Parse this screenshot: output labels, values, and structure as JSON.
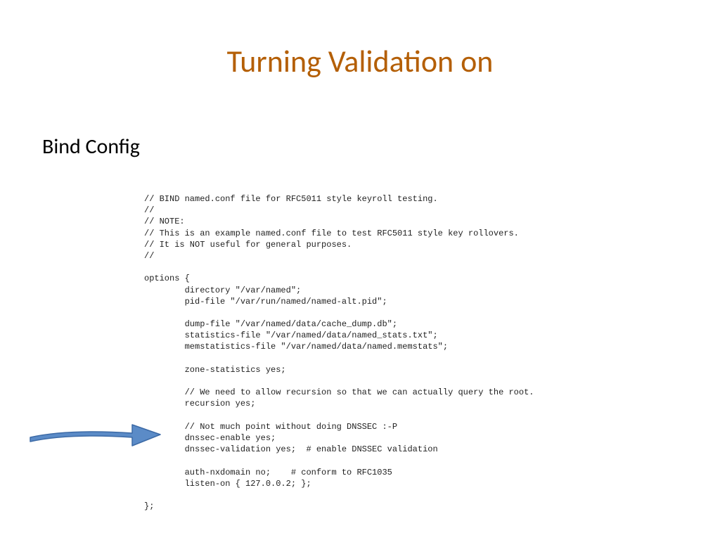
{
  "title": "Turning Validation on",
  "subtitle": "Bind Config",
  "code": "// BIND named.conf file for RFC5011 style keyroll testing.\n//\n// NOTE:\n// This is an example named.conf file to test RFC5011 style key rollovers.\n// It is NOT useful for general purposes.\n//\n\noptions {\n        directory \"/var/named\";\n        pid-file \"/var/run/named/named-alt.pid\";\n\n        dump-file \"/var/named/data/cache_dump.db\";\n        statistics-file \"/var/named/data/named_stats.txt\";\n        memstatistics-file \"/var/named/data/named.memstats\";\n\n        zone-statistics yes;\n\n        // We need to allow recursion so that we can actually query the root.\n        recursion yes;\n\n        // Not much point without doing DNSSEC :-P\n        dnssec-enable yes;\n        dnssec-validation yes;  # enable DNSSEC validation\n\n        auth-nxdomain no;    # conform to RFC1035\n        listen-on { 127.0.0.2; };\n\n};"
}
